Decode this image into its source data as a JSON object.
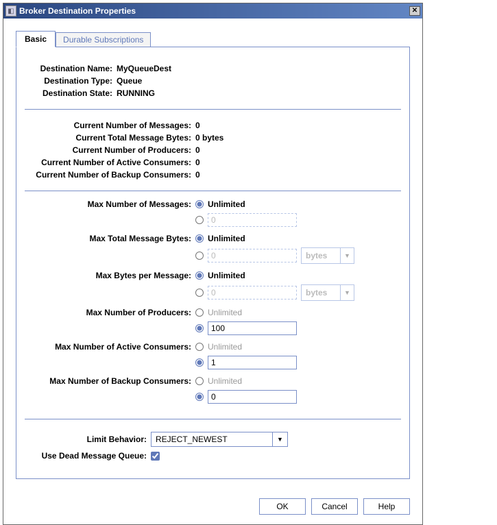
{
  "window": {
    "title": "Broker Destination Properties"
  },
  "tabs": {
    "basic": "Basic",
    "durable": "Durable Subscriptions"
  },
  "info": {
    "name_label": "Destination Name:",
    "name_value": "MyQueueDest",
    "type_label": "Destination Type:",
    "type_value": "Queue",
    "state_label": "Destination State:",
    "state_value": "RUNNING"
  },
  "stats": {
    "msgs_label": "Current Number of Messages:",
    "msgs_value": "0",
    "bytes_label": "Current Total Message Bytes:",
    "bytes_value": "0 bytes",
    "producers_label": "Current Number of Producers:",
    "producers_value": "0",
    "active_label": "Current Number of Active Consumers:",
    "active_value": "0",
    "backup_label": "Current Number of Backup Consumers:",
    "backup_value": "0"
  },
  "config": {
    "unlimited_text": "Unlimited",
    "unit_bytes": "bytes",
    "max_msgs_label": "Max Number of Messages:",
    "max_msgs_input": "0",
    "max_total_bytes_label": "Max Total Message Bytes:",
    "max_total_bytes_input": "0",
    "max_bytes_per_msg_label": "Max Bytes per Message:",
    "max_bytes_per_msg_input": "0",
    "max_producers_label": "Max Number of Producers:",
    "max_producers_input": "100",
    "max_active_label": "Max Number of Active Consumers:",
    "max_active_input": "1",
    "max_backup_label": "Max Number of Backup Consumers:",
    "max_backup_input": "0"
  },
  "bottom": {
    "limit_label": "Limit Behavior:",
    "limit_value": "REJECT_NEWEST",
    "deadq_label": "Use Dead Message Queue:"
  },
  "buttons": {
    "ok": "OK",
    "cancel": "Cancel",
    "help": "Help"
  }
}
